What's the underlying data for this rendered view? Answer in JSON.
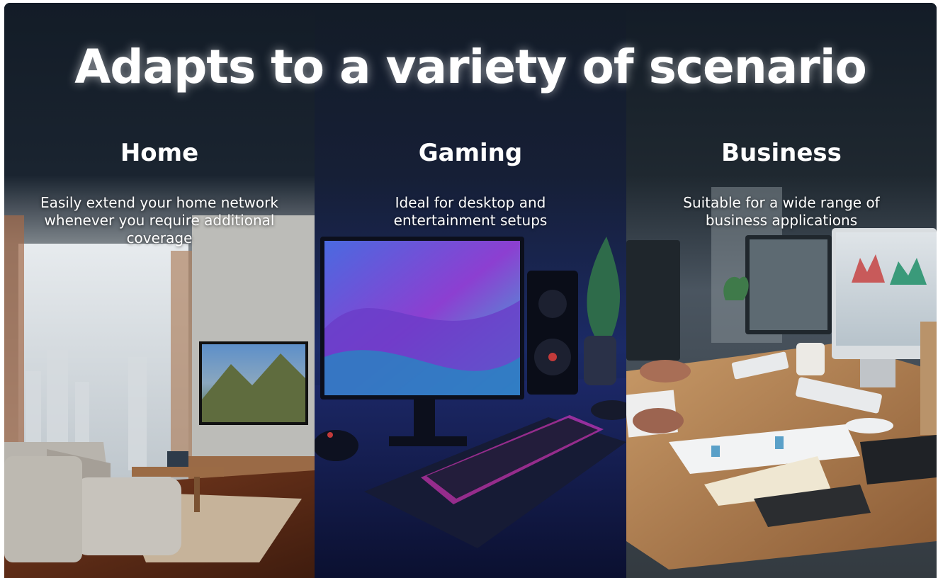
{
  "headline": "Adapts to a variety of scenario",
  "panels": [
    {
      "title": "Home",
      "description": "Easily extend your home network whenever you require additional coverage"
    },
    {
      "title": "Gaming",
      "description": "Ideal for desktop and entertainment setups"
    },
    {
      "title": "Business",
      "description": "Suitable for a wide range of business applications"
    }
  ],
  "colors": {
    "background": "#131c27",
    "text": "#ffffff",
    "gaming_accent": "#ff3bd4"
  }
}
